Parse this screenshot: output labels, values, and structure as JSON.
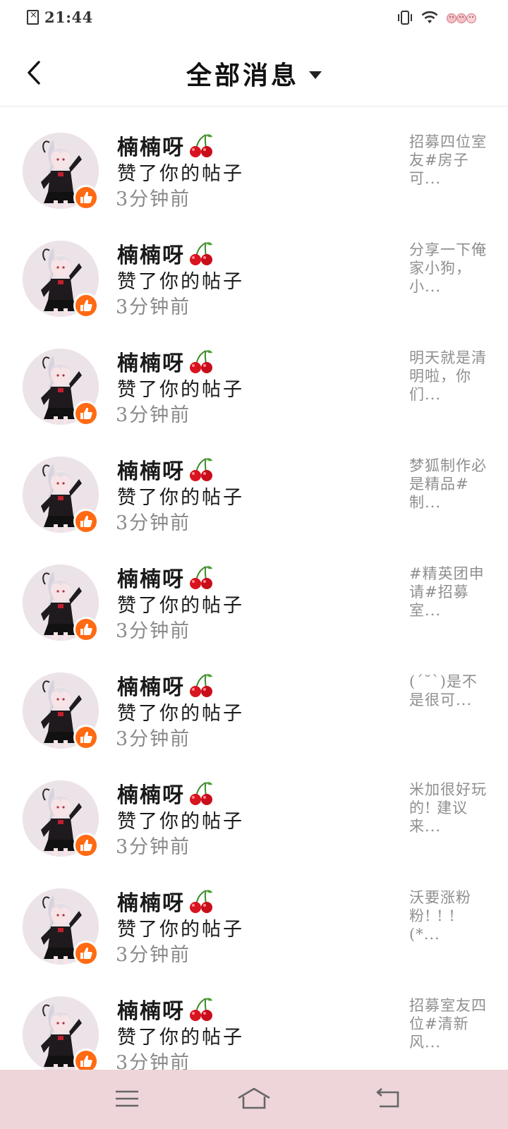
{
  "status_bar": {
    "time": "21:44",
    "icons": [
      "no-sim-icon",
      "vibrate-icon",
      "wifi-icon",
      "battery-icon"
    ]
  },
  "header": {
    "title": "全部消息",
    "back_icon": "chevron-left-icon",
    "dropdown_icon": "caret-down-icon"
  },
  "notifications": [
    {
      "user": "楠楠呀",
      "emoji": "🍒",
      "action": "赞了你的帖子",
      "time": "3分钟前",
      "preview": "招募四位室友#房子可..."
    },
    {
      "user": "楠楠呀",
      "emoji": "🍒",
      "action": "赞了你的帖子",
      "time": "3分钟前",
      "preview": "分享一下俺家小狗，小..."
    },
    {
      "user": "楠楠呀",
      "emoji": "🍒",
      "action": "赞了你的帖子",
      "time": "3分钟前",
      "preview": "明天就是清明啦，你们..."
    },
    {
      "user": "楠楠呀",
      "emoji": "🍒",
      "action": "赞了你的帖子",
      "time": "3分钟前",
      "preview": "梦狐制作必是精品#制..."
    },
    {
      "user": "楠楠呀",
      "emoji": "🍒",
      "action": "赞了你的帖子",
      "time": "3分钟前",
      "preview": "#精英团申请#招募室..."
    },
    {
      "user": "楠楠呀",
      "emoji": "🍒",
      "action": "赞了你的帖子",
      "time": "3分钟前",
      "preview": "(ˊ˘ˋ)是不是很可..."
    },
    {
      "user": "楠楠呀",
      "emoji": "🍒",
      "action": "赞了你的帖子",
      "time": "3分钟前",
      "preview": "米加很好玩的! 建议来..."
    },
    {
      "user": "楠楠呀",
      "emoji": "🍒",
      "action": "赞了你的帖子",
      "time": "3分钟前",
      "preview": "沃要涨粉粉! ! ! (*..."
    },
    {
      "user": "楠楠呀",
      "emoji": "🍒",
      "action": "赞了你的帖子",
      "time": "3分钟前",
      "preview": "招募室友四位#清新风..."
    }
  ],
  "nav_bar": {
    "icons": [
      "menu-icon",
      "home-icon",
      "back-icon"
    ]
  },
  "colors": {
    "badge": "#ff6a13",
    "nav_bg": "#edd5da",
    "secondary_text": "#8a8a8a"
  }
}
